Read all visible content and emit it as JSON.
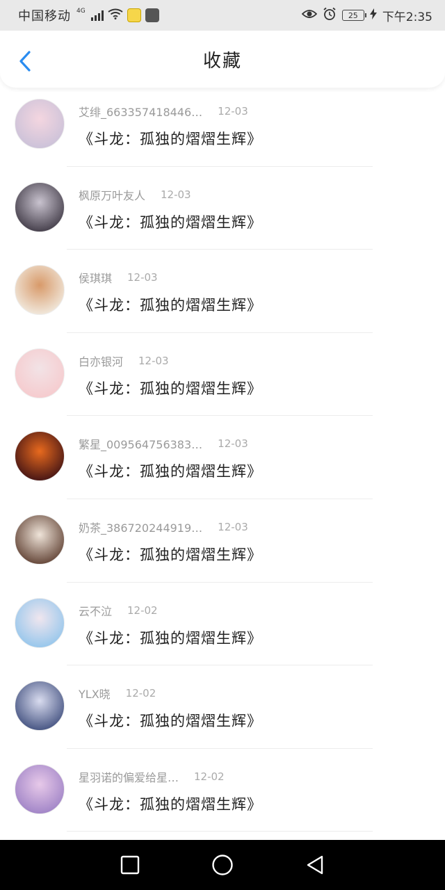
{
  "status_bar": {
    "carrier": "中国移动",
    "network": "4G",
    "battery": "25",
    "time": "下午2:35"
  },
  "nav": {
    "title": "收藏",
    "accent_color": "#2a8cf0"
  },
  "favorites": [
    {
      "name": "艾绯_663357418446…",
      "date": "12-03",
      "title": "《斗龙：孤独的熠熠生辉》",
      "avatar_colors": [
        "#c8c0d8",
        "#f4d6e0"
      ]
    },
    {
      "name": "枫原万叶友人",
      "date": "12-03",
      "title": "《斗龙：孤独的熠熠生辉》",
      "avatar_colors": [
        "#3a3440",
        "#c9c3cf"
      ]
    },
    {
      "name": "侯琪琪",
      "date": "12-03",
      "title": "《斗龙：孤独的熠熠生辉》",
      "avatar_colors": [
        "#f3efe6",
        "#d89a6a"
      ]
    },
    {
      "name": "白亦银河",
      "date": "12-03",
      "title": "《斗龙：孤独的熠熠生辉》",
      "avatar_colors": [
        "#f6c9cc",
        "#f2e3e6"
      ]
    },
    {
      "name": "繁星_009564756383…",
      "date": "12-03",
      "title": "《斗龙：孤独的熠熠生辉》",
      "avatar_colors": [
        "#3a0f14",
        "#e86a1e"
      ]
    },
    {
      "name": "奶茶_386720244919…",
      "date": "12-03",
      "title": "《斗龙：孤独的熠熠生辉》",
      "avatar_colors": [
        "#5a3a2c",
        "#efe4d9"
      ]
    },
    {
      "name": "云不泣",
      "date": "12-02",
      "title": "《斗龙：孤独的熠熠生辉》",
      "avatar_colors": [
        "#8fc4ec",
        "#f0e6ee"
      ]
    },
    {
      "name": "YLX晓",
      "date": "12-02",
      "title": "《斗龙：孤独的熠熠生辉》",
      "avatar_colors": [
        "#3b4a7a",
        "#d9dcef"
      ]
    },
    {
      "name": "星羽诺的偏爱给星…",
      "date": "12-02",
      "title": "《斗龙：孤独的熠熠生辉》",
      "avatar_colors": [
        "#9b7fc4",
        "#e7c9e9"
      ]
    }
  ]
}
